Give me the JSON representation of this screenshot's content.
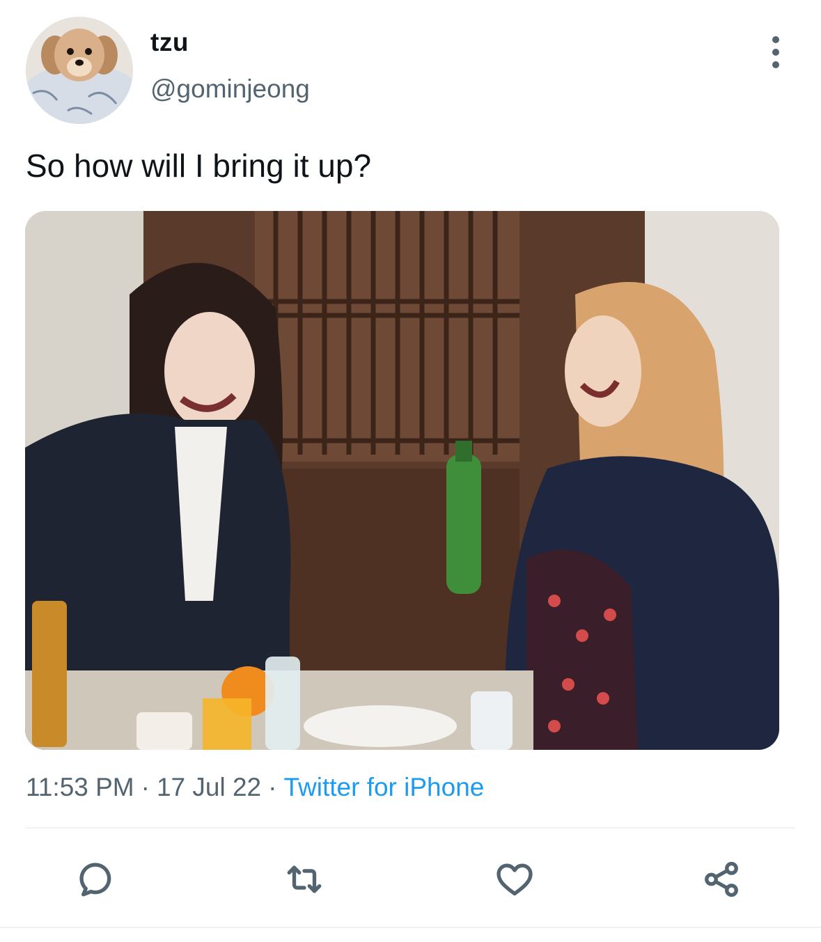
{
  "author": {
    "display_name": "tzu",
    "handle": "@gominjeong",
    "avatar_icon": "dog-avatar"
  },
  "tweet": {
    "text": "So how will I bring it up?",
    "media_description_icon": "photo-two-women-laughing"
  },
  "meta": {
    "time": "11:53 PM",
    "separator": "·",
    "date": "17 Jul 22",
    "source": "Twitter for iPhone"
  },
  "actions": {
    "reply_icon": "reply-icon",
    "retweet_icon": "retweet-icon",
    "like_icon": "heart-icon",
    "share_icon": "share-icon"
  },
  "colors": {
    "text": "#0f1419",
    "secondary": "#536471",
    "link": "#1d9bf0",
    "divider": "#eff3f4"
  }
}
